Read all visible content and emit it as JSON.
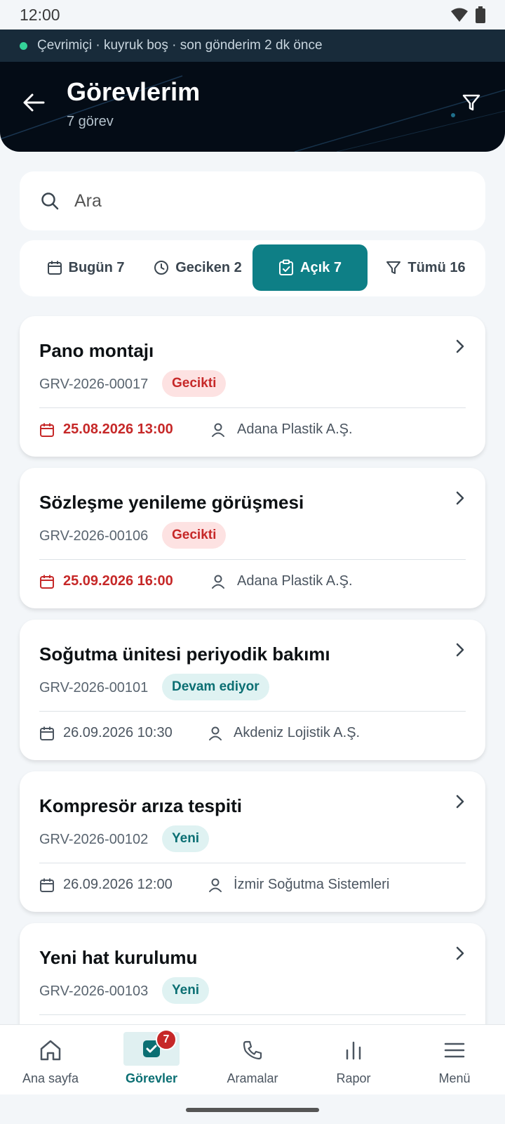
{
  "status_bar": {
    "time": "12:00"
  },
  "connection": {
    "text": "Çevrimiçi · kuyruk boş · son gönderim 2 dk önce"
  },
  "header": {
    "title": "Görevlerim",
    "subtitle": "7 görev"
  },
  "search": {
    "placeholder": "Ara"
  },
  "tabs": [
    {
      "label": "Bugün 7",
      "icon": "calendar-icon"
    },
    {
      "label": "Geciken 2",
      "icon": "clock-icon"
    },
    {
      "label": "Açık 7",
      "icon": "clipboard-check-icon",
      "active": true
    },
    {
      "label": "Tümü 16",
      "icon": "filter-icon"
    }
  ],
  "tasks": [
    {
      "title": "Pano montajı",
      "code": "GRV-2026-00017",
      "status": "Gecikti",
      "date": "25.08.2026 13:00",
      "customer": "Adana Plastik A.Ş."
    },
    {
      "title": "Sözleşme yenileme görüşmesi",
      "code": "GRV-2026-00106",
      "status": "Gecikti",
      "date": "25.09.2026 16:00",
      "customer": "Adana Plastik A.Ş."
    },
    {
      "title": "Soğutma ünitesi periyodik bakımı",
      "code": "GRV-2026-00101",
      "status": "Devam ediyor",
      "date": "26.09.2026 10:30",
      "customer": "Akdeniz Lojistik A.Ş."
    },
    {
      "title": "Kompresör arıza tespiti",
      "code": "GRV-2026-00102",
      "status": "Yeni",
      "date": "26.09.2026 12:00",
      "customer": "İzmir Soğutma Sistemleri"
    },
    {
      "title": "Yeni hat kurulumu",
      "code": "GRV-2026-00103",
      "status": "Yeni"
    }
  ],
  "nav": [
    {
      "label": "Ana sayfa",
      "icon": "home-icon"
    },
    {
      "label": "Görevler",
      "icon": "task-check-icon",
      "active": true,
      "badge": "7"
    },
    {
      "label": "Aramalar",
      "icon": "phone-icon"
    },
    {
      "label": "Rapor",
      "icon": "bar-chart-icon"
    },
    {
      "label": "Menü",
      "icon": "menu-icon"
    }
  ],
  "colors": {
    "accent": "#0e7f86",
    "late": "#c62828",
    "header_bg": "#040c16",
    "online": "#34d399"
  }
}
